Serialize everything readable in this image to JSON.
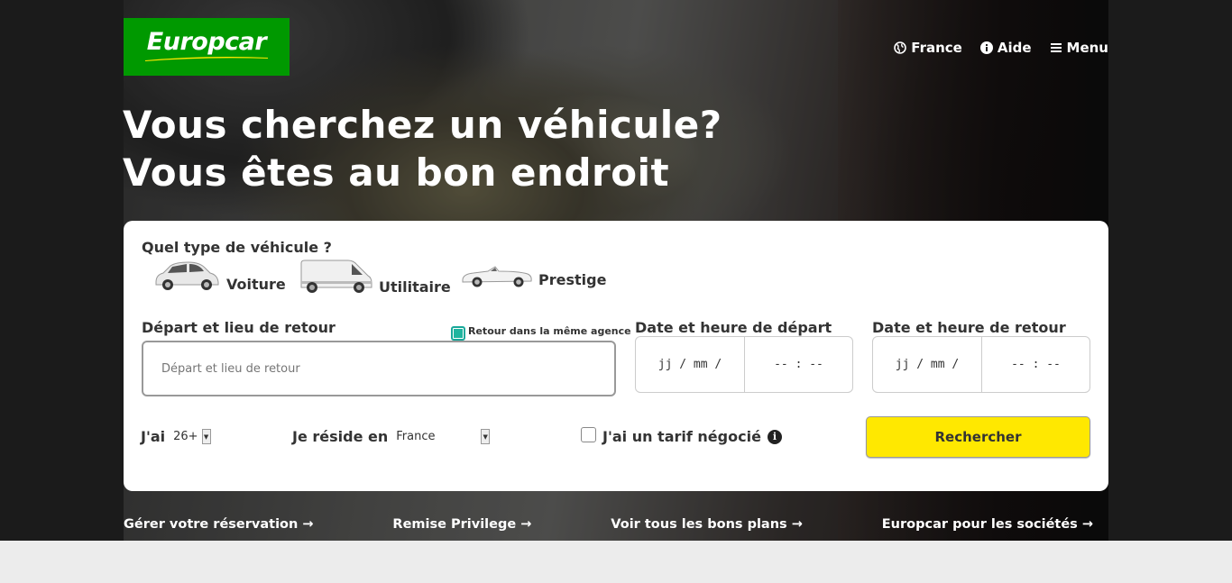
{
  "header": {
    "brand": "Europcar",
    "nav": [
      {
        "label": "France",
        "icon": "globe-icon"
      },
      {
        "label": "Aide",
        "icon": "info-icon"
      },
      {
        "label": "Menu",
        "icon": "hamburger-icon"
      }
    ]
  },
  "hero": {
    "line1": "Vous cherchez un véhicule?",
    "line2": "Vous êtes au bon endroit"
  },
  "booking": {
    "vehicle_question": "Quel type de véhicule ?",
    "vehicle_types": [
      "Voiture",
      "Utilitaire",
      "Prestige"
    ],
    "location_label": "Départ et lieu de retour",
    "same_agency_label": "Retour dans la même agence",
    "same_agency_checked": true,
    "location_placeholder": "Départ et lieu de retour",
    "departure_label": "Date et heure de départ",
    "return_label": "Date et heure de retour",
    "date_placeholder": "jj / mm /",
    "time_placeholder": "-- : --",
    "age_label": "J'ai",
    "age_value": "26+",
    "residence_label": "Je réside en",
    "residence_value": "France",
    "negotiated_label": "J'ai un tarif négocié",
    "negotiated_checked": false,
    "search_button": "Rechercher"
  },
  "links": [
    "Gérer votre réservation →",
    "Remise Privilege →",
    "Voir tous les bons plans →",
    "Europcar pour les sociétés →"
  ],
  "colors": {
    "brand_green": "#009900",
    "search_yellow": "#ffe800",
    "checkbox_teal": "#1fb59f"
  }
}
